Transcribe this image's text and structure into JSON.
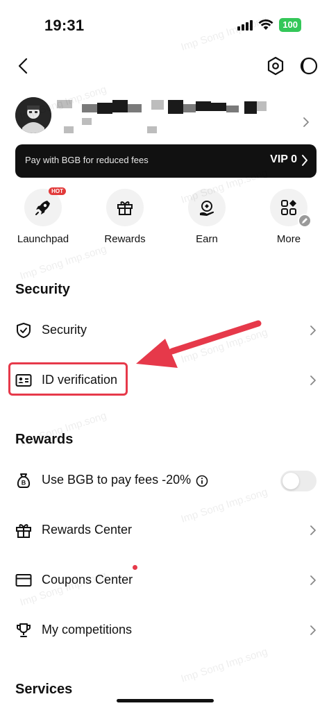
{
  "status_bar": {
    "time": "19:31",
    "battery": "100"
  },
  "vip_banner": {
    "text": "Pay with BGB for reduced fees",
    "level": "VIP 0"
  },
  "quick_actions": [
    {
      "label": "Launchpad",
      "badge": "HOT"
    },
    {
      "label": "Rewards"
    },
    {
      "label": "Earn"
    },
    {
      "label": "More"
    }
  ],
  "sections": {
    "security": {
      "title": "Security",
      "items": [
        {
          "label": "Security"
        },
        {
          "label": "ID verification"
        }
      ]
    },
    "rewards": {
      "title": "Rewards",
      "items": [
        {
          "label": "Use BGB to pay fees -20%",
          "toggle": false
        },
        {
          "label": "Rewards Center"
        },
        {
          "label": "Coupons Center",
          "dot": true
        },
        {
          "label": "My competitions"
        }
      ]
    },
    "services": {
      "title": "Services"
    }
  },
  "colors": {
    "accent_red": "#e6394a",
    "battery_green": "#34c759",
    "banner_bg": "#111111"
  },
  "watermark": "Imp Song Imp.song"
}
